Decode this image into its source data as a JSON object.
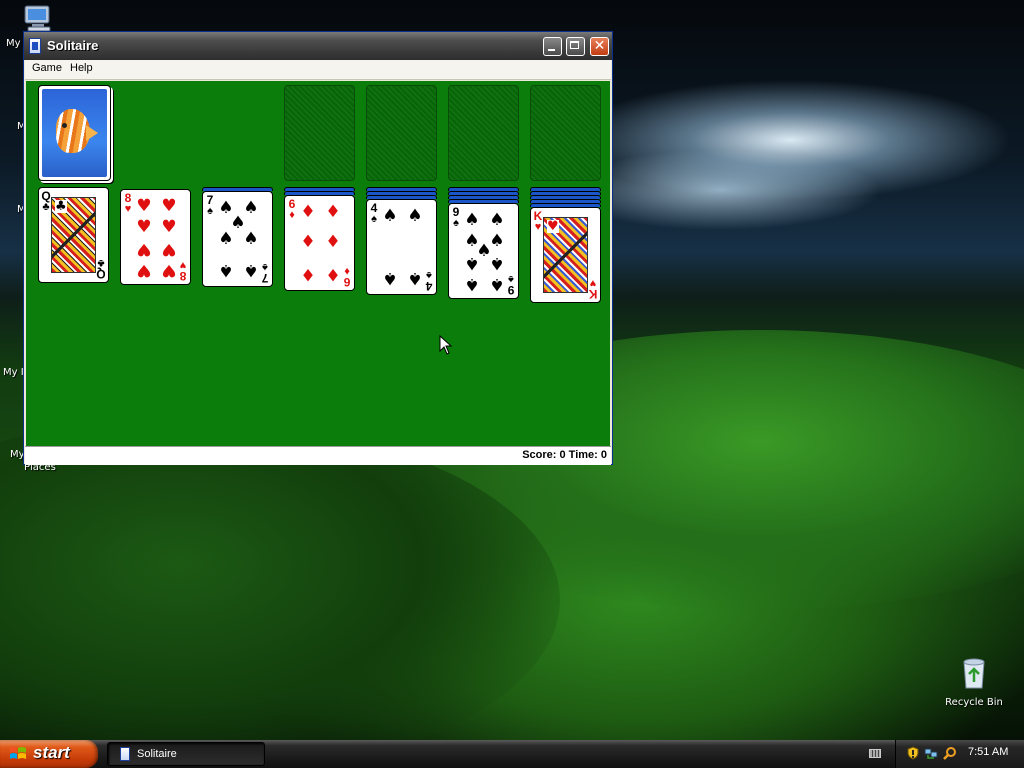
{
  "desktop": {
    "left_icon_fragments": [
      "My",
      "M",
      "M",
      "My I",
      "My",
      "Places"
    ],
    "recycle_bin_label": "Recycle Bin"
  },
  "window": {
    "title": "Solitaire",
    "close_glyph": "✕",
    "menu": {
      "game": "Game",
      "help": "Help"
    },
    "status": "Score: 0 Time: 0"
  },
  "game": {
    "stock": "face-down",
    "foundations": [
      "empty",
      "empty",
      "empty",
      "empty"
    ],
    "tableau": [
      {
        "face_down": 0,
        "rank": "Q",
        "suit": "♣",
        "color": "black"
      },
      {
        "face_down": 0,
        "rank": "8",
        "suit": "♥",
        "color": "red"
      },
      {
        "face_down": 1,
        "rank": "7",
        "suit": "♠",
        "color": "black"
      },
      {
        "face_down": 2,
        "rank": "6",
        "suit": "♦",
        "color": "red"
      },
      {
        "face_down": 3,
        "rank": "4",
        "suit": "♠",
        "color": "black"
      },
      {
        "face_down": 4,
        "rank": "9",
        "suit": "♠",
        "color": "black"
      },
      {
        "face_down": 5,
        "rank": "K",
        "suit": "♥",
        "color": "red"
      }
    ]
  },
  "taskbar": {
    "start_label": "start",
    "task_label": "Solitaire",
    "clock": "7:51 AM"
  },
  "colors": {
    "felt": "#0b7d0b",
    "card_back": "#1b56c8",
    "red_suit": "#e01010",
    "start_button": "#c63c08"
  }
}
